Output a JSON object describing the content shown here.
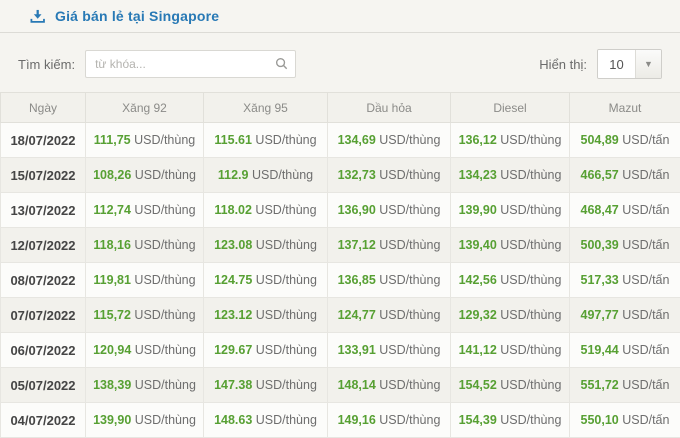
{
  "header": {
    "title": "Giá bán lẻ tại Singapore"
  },
  "controls": {
    "search_label": "Tìm kiếm:",
    "search_placeholder": "từ khóa...",
    "page_size_label": "Hiển thị:",
    "page_size_value": "10"
  },
  "icons": {
    "download": "download-icon",
    "search": "search-icon",
    "dropdown": "chevron-down-icon"
  },
  "colors": {
    "title_blue": "#2879b5",
    "value_green": "#57a033",
    "header_text": "#8b8b88",
    "date_text": "#454545",
    "row_alt_bg": "#f2f1ec"
  },
  "table": {
    "columns": [
      "Ngày",
      "Xăng 92",
      "Xăng 95",
      "Dầu hỏa",
      "Diesel",
      "Mazut"
    ],
    "column_units": [
      "",
      "USD/thùng",
      "USD/thùng",
      "USD/thùng",
      "USD/thùng",
      "USD/tấn"
    ],
    "rows": [
      {
        "date": "18/07/2022",
        "values": [
          "111,75",
          "115.61",
          "134,69",
          "136,12",
          "504,89"
        ]
      },
      {
        "date": "15/07/2022",
        "values": [
          "108,26",
          "112.9",
          "132,73",
          "134,23",
          "466,57"
        ]
      },
      {
        "date": "13/07/2022",
        "values": [
          "112,74",
          "118.02",
          "136,90",
          "139,90",
          "468,47"
        ]
      },
      {
        "date": "12/07/2022",
        "values": [
          "118,16",
          "123.08",
          "137,12",
          "139,40",
          "500,39"
        ]
      },
      {
        "date": "08/07/2022",
        "values": [
          "119,81",
          "124.75",
          "136,85",
          "142,56",
          "517,33"
        ]
      },
      {
        "date": "07/07/2022",
        "values": [
          "115,72",
          "123.12",
          "124,77",
          "129,32",
          "497,77"
        ]
      },
      {
        "date": "06/07/2022",
        "values": [
          "120,94",
          "129.67",
          "133,91",
          "141,12",
          "519,44"
        ]
      },
      {
        "date": "05/07/2022",
        "values": [
          "138,39",
          "147.38",
          "148,14",
          "154,52",
          "551,72"
        ]
      },
      {
        "date": "04/07/2022",
        "values": [
          "139,90",
          "148.63",
          "149,16",
          "154,39",
          "550,10"
        ]
      }
    ]
  }
}
